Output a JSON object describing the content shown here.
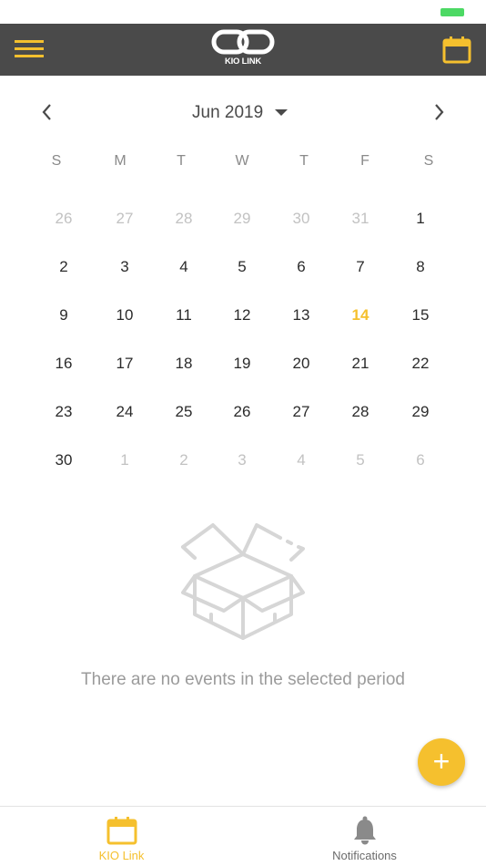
{
  "header": {
    "logo_text": "KIO LINK"
  },
  "month_nav": {
    "label": "Jun 2019"
  },
  "weekdays": [
    "S",
    "M",
    "T",
    "W",
    "T",
    "F",
    "S"
  ],
  "calendar": {
    "weeks": [
      [
        {
          "d": "26",
          "m": true
        },
        {
          "d": "27",
          "m": true
        },
        {
          "d": "28",
          "m": true
        },
        {
          "d": "29",
          "m": true
        },
        {
          "d": "30",
          "m": true
        },
        {
          "d": "31",
          "m": true
        },
        {
          "d": "1"
        }
      ],
      [
        {
          "d": "2"
        },
        {
          "d": "3"
        },
        {
          "d": "4"
        },
        {
          "d": "5"
        },
        {
          "d": "6"
        },
        {
          "d": "7"
        },
        {
          "d": "8"
        }
      ],
      [
        {
          "d": "9"
        },
        {
          "d": "10"
        },
        {
          "d": "11"
        },
        {
          "d": "12"
        },
        {
          "d": "13"
        },
        {
          "d": "14",
          "today": true
        },
        {
          "d": "15"
        }
      ],
      [
        {
          "d": "16"
        },
        {
          "d": "17"
        },
        {
          "d": "18"
        },
        {
          "d": "19"
        },
        {
          "d": "20"
        },
        {
          "d": "21"
        },
        {
          "d": "22"
        }
      ],
      [
        {
          "d": "23"
        },
        {
          "d": "24"
        },
        {
          "d": "25"
        },
        {
          "d": "26"
        },
        {
          "d": "27"
        },
        {
          "d": "28"
        },
        {
          "d": "29"
        }
      ],
      [
        {
          "d": "30"
        },
        {
          "d": "1",
          "m": true
        },
        {
          "d": "2",
          "m": true
        },
        {
          "d": "3",
          "m": true
        },
        {
          "d": "4",
          "m": true
        },
        {
          "d": "5",
          "m": true
        },
        {
          "d": "6",
          "m": true
        }
      ]
    ]
  },
  "empty_state": {
    "message": "There are no events in the selected period"
  },
  "fab": {
    "label": "+"
  },
  "tabs": [
    {
      "label": "KIO Link",
      "icon": "calendar-icon",
      "active": true
    },
    {
      "label": "Notifications",
      "icon": "bell-icon",
      "active": false
    }
  ],
  "colors": {
    "accent": "#f5c02e",
    "header_bg": "#4a4a4a",
    "battery": "#4cd964"
  }
}
